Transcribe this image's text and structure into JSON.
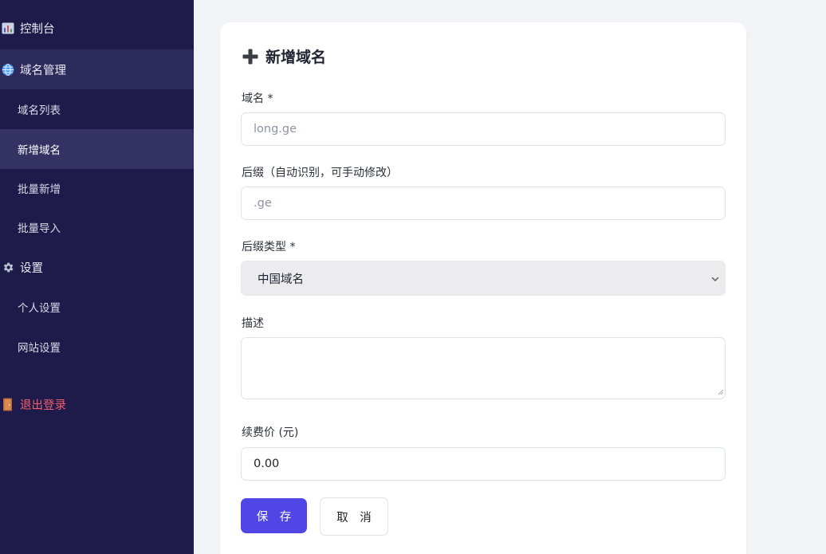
{
  "sidebar": {
    "items": [
      {
        "label": "控制台",
        "icon": "bar-chart-icon"
      },
      {
        "label": "域名管理",
        "icon": "globe-icon"
      },
      {
        "label": "域名列表"
      },
      {
        "label": "新增域名"
      },
      {
        "label": "批量新增"
      },
      {
        "label": "批量导入"
      },
      {
        "label": "设置",
        "icon": "gear-icon"
      },
      {
        "label": "个人设置"
      },
      {
        "label": "网站设置"
      },
      {
        "label": "退出登录",
        "icon": "door-icon"
      }
    ]
  },
  "form": {
    "title": "新增域名",
    "title_icon": "plus-icon",
    "domain": {
      "label": "域名 *",
      "placeholder": "long.ge",
      "value": ""
    },
    "suffix": {
      "label": "后缀（自动识别，可手动修改）",
      "placeholder": ".ge",
      "value": ""
    },
    "suffix_type": {
      "label": "后缀类型 *",
      "selected": "中国域名"
    },
    "description": {
      "label": "描述",
      "value": ""
    },
    "renewal_price": {
      "label": "续费价 (元)",
      "value": "0.00"
    },
    "save_label": "保 存",
    "cancel_label": "取 消"
  },
  "colors": {
    "sidebar_bg": "#1e1b4b",
    "accent": "#4f46e5",
    "logout": "#f25f6d",
    "page_bg": "#f2f3f6"
  }
}
